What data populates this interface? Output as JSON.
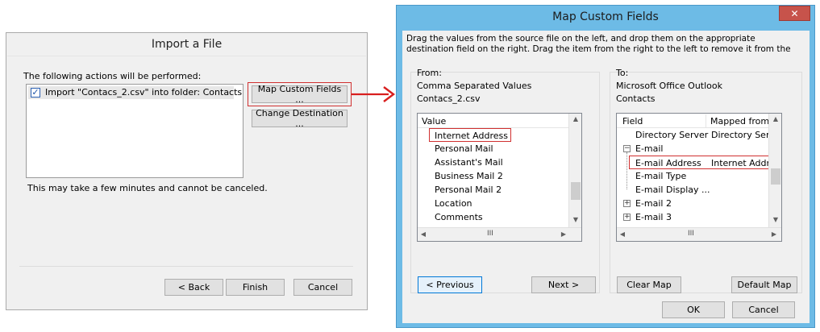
{
  "import_dialog": {
    "title": "Import a File",
    "actions_label": "The following actions will be performed:",
    "action_item": "Import \"Contacs_2.csv\" into folder: Contacts",
    "action_checked": true,
    "map_custom_fields_button": "Map Custom Fields ...",
    "change_destination_button": "Change Destination ...",
    "note": "This may take a few minutes and cannot be canceled.",
    "back_button": "< Back",
    "finish_button": "Finish",
    "cancel_button": "Cancel"
  },
  "map_dialog": {
    "title": "Map Custom Fields",
    "close_glyph": "✕",
    "instructions_line1": "Drag the values from the source file on the left, and drop them on the appropriate",
    "instructions_line2": "destination field on the right.  Drag the item from the right to the left to remove it from the",
    "from": {
      "label": "From:",
      "source_type": "Comma Separated Values",
      "source_file": "Contacs_2.csv",
      "column_header": "Value",
      "items": [
        "Internet Address",
        "Personal Mail",
        "Assistant's Mail",
        "Business Mail 2",
        "Personal Mail 2",
        "Location",
        "Comments"
      ]
    },
    "to": {
      "label": "To:",
      "dest_app": "Microsoft Office Outlook",
      "dest_folder": "Contacts",
      "col_field": "Field",
      "col_mapped": "Mapped from",
      "rows": [
        {
          "field": "Directory Server",
          "mapped": "Directory Server"
        },
        {
          "field": "E-mail",
          "mapped": ""
        },
        {
          "field": "E-mail Address",
          "mapped": "Internet Address"
        },
        {
          "field": "E-mail Type",
          "mapped": ""
        },
        {
          "field": "E-mail Display ...",
          "mapped": ""
        },
        {
          "field": "E-mail 2",
          "mapped": ""
        },
        {
          "field": "E-mail 3",
          "mapped": ""
        }
      ],
      "collapse_glyph": "−",
      "expand_glyph": "+"
    },
    "scroll_thumb_glyph": "III",
    "previous_button": "< Previous",
    "next_button": "Next >",
    "clear_map_button": "Clear Map",
    "default_map_button": "Default Map",
    "ok_button": "OK",
    "cancel_button": "Cancel"
  },
  "colors": {
    "highlight": "#d03030",
    "connector": "#d81e1e",
    "window_frame": "#6dbbe6",
    "dialog_bg": "#f0f0f0"
  }
}
